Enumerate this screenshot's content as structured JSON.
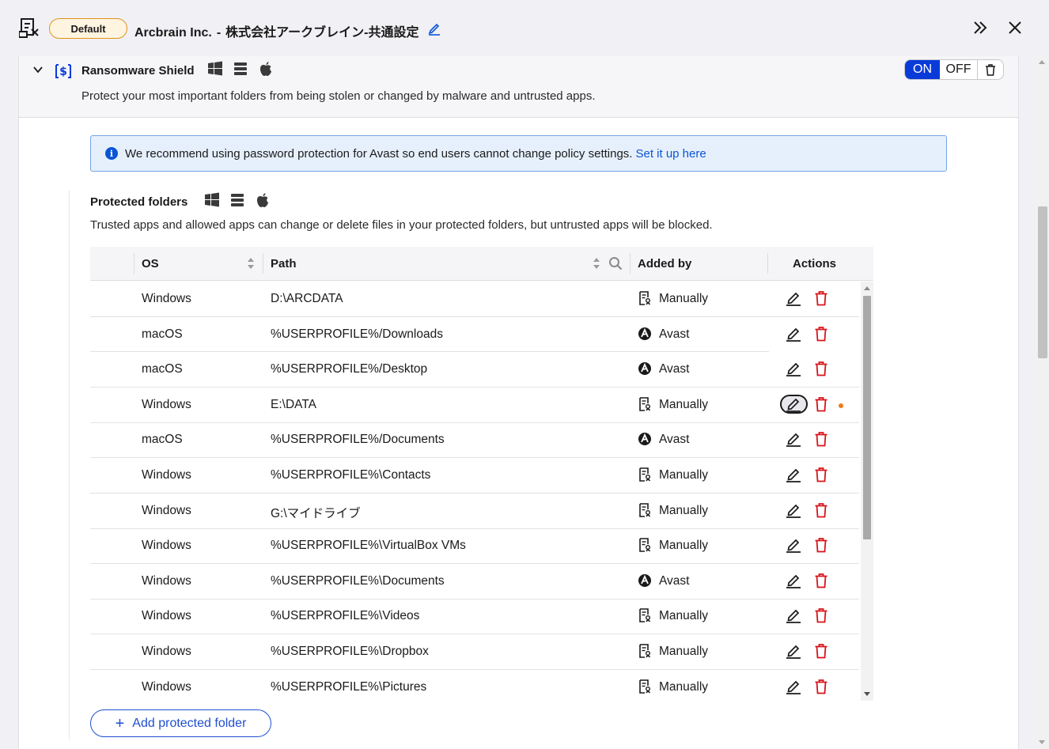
{
  "header": {
    "badge": "Default",
    "company": "Arcbrain Inc.",
    "separator": "-",
    "policy_name": "株式会社アークブレイン-共通設定"
  },
  "section": {
    "title": "Ransomware Shield",
    "description": "Protect your most important folders from being stolen or changed by malware and untrusted apps.",
    "toggle_on": "ON",
    "toggle_off": "OFF"
  },
  "notice": {
    "icon": "i",
    "text": "We recommend using password protection for Avast so end users cannot change policy settings.",
    "link": "Set it up here"
  },
  "protected_folders": {
    "title": "Protected folders",
    "description": "Trusted apps and allowed apps can change or delete files in your protected folders, but untrusted apps will be blocked."
  },
  "table": {
    "columns": {
      "os": "OS",
      "path": "Path",
      "added_by": "Added by",
      "actions": "Actions"
    },
    "rows": [
      {
        "os": "Windows",
        "path": "D:\\ARCDATA",
        "added_by": "Manually",
        "source_icon": "manual-doc-icon"
      },
      {
        "os": "macOS",
        "path": "%USERPROFILE%/Downloads",
        "added_by": "Avast",
        "source_icon": "avast-logo-icon"
      },
      {
        "os": "macOS",
        "path": "%USERPROFILE%/Desktop",
        "added_by": "Avast",
        "source_icon": "avast-logo-icon"
      },
      {
        "os": "Windows",
        "path": "E:\\DATA",
        "added_by": "Manually",
        "source_icon": "manual-doc-icon"
      },
      {
        "os": "macOS",
        "path": "%USERPROFILE%/Documents",
        "added_by": "Avast",
        "source_icon": "avast-logo-icon"
      },
      {
        "os": "Windows",
        "path": "%USERPROFILE%\\Contacts",
        "added_by": "Manually",
        "source_icon": "manual-doc-icon"
      },
      {
        "os": "Windows",
        "path": "G:\\マイドライブ",
        "added_by": "Manually",
        "source_icon": "manual-doc-icon"
      },
      {
        "os": "Windows",
        "path": "%USERPROFILE%\\VirtualBox VMs",
        "added_by": "Manually",
        "source_icon": "manual-doc-icon"
      },
      {
        "os": "Windows",
        "path": "%USERPROFILE%\\Documents",
        "added_by": "Avast",
        "source_icon": "avast-logo-icon"
      },
      {
        "os": "Windows",
        "path": "%USERPROFILE%\\Videos",
        "added_by": "Manually",
        "source_icon": "manual-doc-icon"
      },
      {
        "os": "Windows",
        "path": "%USERPROFILE%\\Dropbox",
        "added_by": "Manually",
        "source_icon": "manual-doc-icon"
      },
      {
        "os": "Windows",
        "path": "%USERPROFILE%\\Pictures",
        "added_by": "Manually",
        "source_icon": "manual-doc-icon"
      }
    ]
  },
  "add_button": {
    "plus": "+",
    "label": "Add protected folder"
  },
  "colors": {
    "accent": "#0a3bd9",
    "link": "#0a55d6",
    "danger": "#d8141b",
    "badge_border": "#e0941c",
    "unsaved_dot": "#f07a1a"
  }
}
